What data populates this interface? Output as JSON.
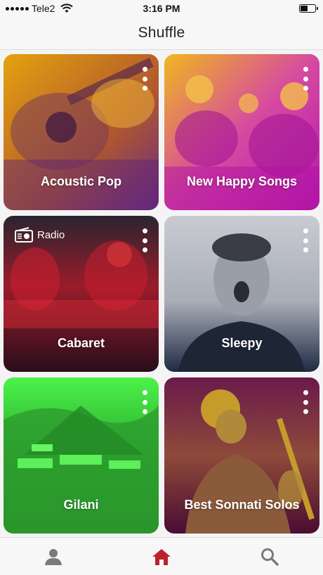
{
  "status_bar": {
    "carrier": "Tele2",
    "time": "3:16 PM"
  },
  "header": {
    "title": "Shuffle"
  },
  "playlists": [
    {
      "title": "Acoustic Pop",
      "theme": "orange-purple",
      "colors": [
        "#e5a20f",
        "#7a2a86"
      ]
    },
    {
      "title": "New Happy Songs",
      "theme": "magenta-yellow",
      "colors": [
        "#f0b81d",
        "#c71cb2"
      ]
    },
    {
      "title": "Cabaret",
      "theme": "red-dark",
      "colors": [
        "#c81e2e",
        "#2a0d1c"
      ],
      "badge": {
        "icon": "radio-icon",
        "label": "Radio"
      }
    },
    {
      "title": "Sleepy",
      "theme": "gray-navy",
      "colors": [
        "#c2c5cc",
        "#1f2a44"
      ]
    },
    {
      "title": "Gilani",
      "theme": "green",
      "colors": [
        "#3ddc3a",
        "#137a1b"
      ]
    },
    {
      "title": "Best Sonnati Solos",
      "theme": "gold-maroon",
      "colors": [
        "#c29625",
        "#5a0f3a"
      ]
    }
  ],
  "tab_bar": {
    "tabs": [
      {
        "icon": "person-icon",
        "active": false
      },
      {
        "icon": "home-icon",
        "active": true
      },
      {
        "icon": "search-icon",
        "active": false
      }
    ],
    "active_color": "#b8242a",
    "inactive_color": "#7a7a7a"
  }
}
